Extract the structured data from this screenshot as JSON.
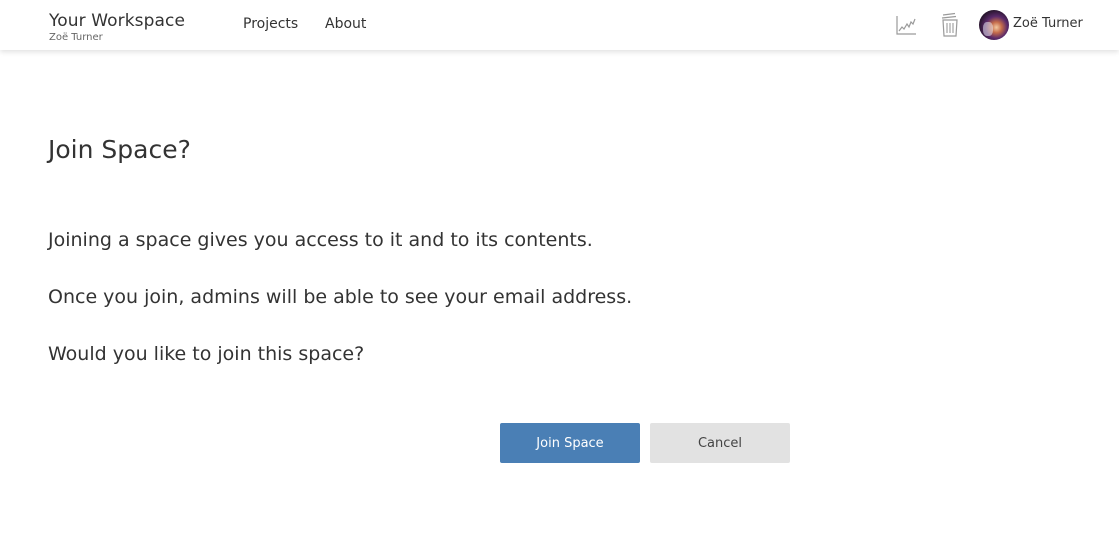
{
  "header": {
    "title": "Your Workspace",
    "subtitle": "Zoë Turner",
    "nav": [
      {
        "label": "Projects"
      },
      {
        "label": "About"
      }
    ],
    "icons": {
      "activity": "activity-chart-icon",
      "trash": "trash-icon"
    },
    "user": {
      "name": "Zoë Turner"
    }
  },
  "main": {
    "title": "Join Space?",
    "paragraphs": [
      "Joining a space gives you access to it and to its contents.",
      "Once you join, admins will be able to see your email address.",
      "Would you like to join this space?"
    ],
    "buttons": {
      "join": "Join Space",
      "cancel": "Cancel"
    }
  },
  "colors": {
    "primary": "#4a7fb5",
    "secondary": "#e2e2e2",
    "text": "#333333"
  }
}
